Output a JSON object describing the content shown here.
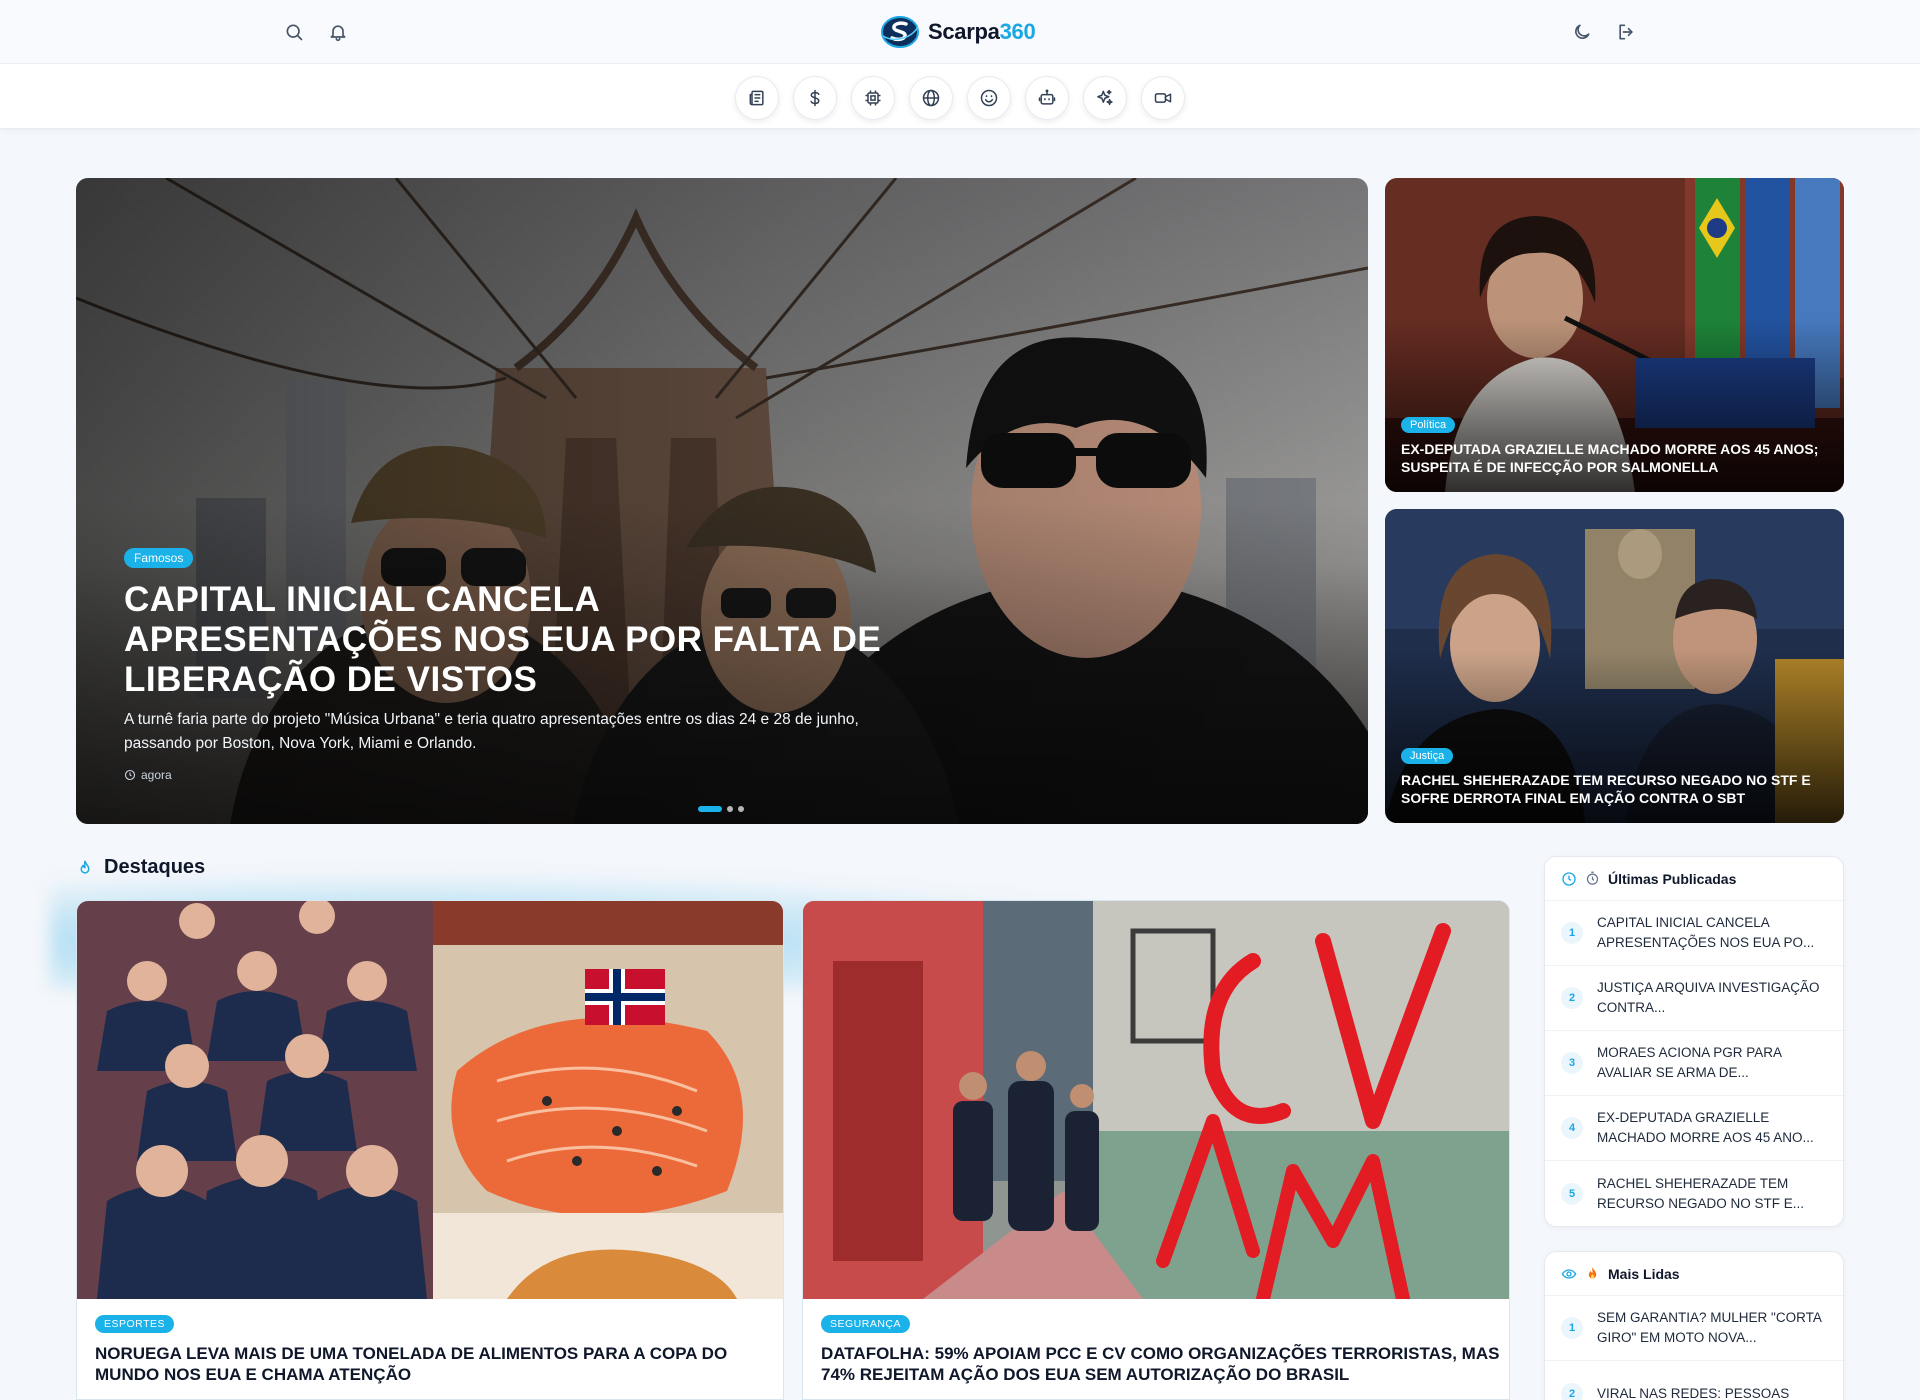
{
  "brand": {
    "name": "Scarpa",
    "accent": "360"
  },
  "header_icons": [
    "search-icon",
    "bell-icon",
    "moon-icon",
    "logout-icon"
  ],
  "categories": [
    "newspaper-icon",
    "dollar-icon",
    "cpu-icon",
    "globe-icon",
    "smile-icon",
    "robot-icon",
    "sparkles-icon",
    "video-icon"
  ],
  "hero": {
    "badge": "Famosos",
    "title": "Capital Inicial cancela apresentações nos EUA por falta de liberação de vistos",
    "summary": "A turnê faria parte do projeto \"Música Urbana\" e teria quatro apresentações entre os dias 24 e 28 de junho, passando por Boston, Nova York, Miami e Orlando.",
    "time": "agora",
    "slides": 3,
    "active_slide": 1
  },
  "side_stories": [
    {
      "badge": "Política",
      "title": "Ex-deputada Grazielle Machado morre aos 45 anos; suspeita é de infecção por salmonella"
    },
    {
      "badge": "Justiça",
      "title": "Rachel Sheherazade tem recurso negado no STF e sofre derrota final em ação contra o SBT"
    }
  ],
  "destaques": {
    "title": "Destaques",
    "items": [
      {
        "badge": "ESPORTES",
        "title": "Noruega leva mais de uma tonelada de alimentos para a Copa do Mundo nos EUA e chama atenção"
      },
      {
        "badge": "SEGURANÇA",
        "title": "Datafolha: 59% apoiam PCC e CV como organizações terroristas, mas 74% rejeitam ação dos EUA sem autorização do Brasil"
      }
    ]
  },
  "latest": {
    "title": "Últimas Publicadas",
    "items": [
      {
        "n": "1",
        "text": "Capital Inicial cancela apresentações nos EUA po..."
      },
      {
        "n": "2",
        "text": "Justiça arquiva investigação contra..."
      },
      {
        "n": "3",
        "text": "Moraes aciona PGR para avaliar se arma de..."
      },
      {
        "n": "4",
        "text": "Ex-deputada Grazielle Machado morre aos 45 ano..."
      },
      {
        "n": "5",
        "text": "Rachel Sheherazade tem recurso negado no STF e..."
      }
    ]
  },
  "most_read": {
    "title": "Mais Lidas",
    "items": [
      {
        "n": "1",
        "text": "Sem garantia? Mulher \"corta giro\" em moto nova..."
      },
      {
        "n": "2",
        "text": "Viral nas redes: pessoas"
      }
    ]
  },
  "colors": {
    "accent": "#1aa7e3",
    "badge": "#1ab2e8",
    "text": "#0f172a"
  }
}
